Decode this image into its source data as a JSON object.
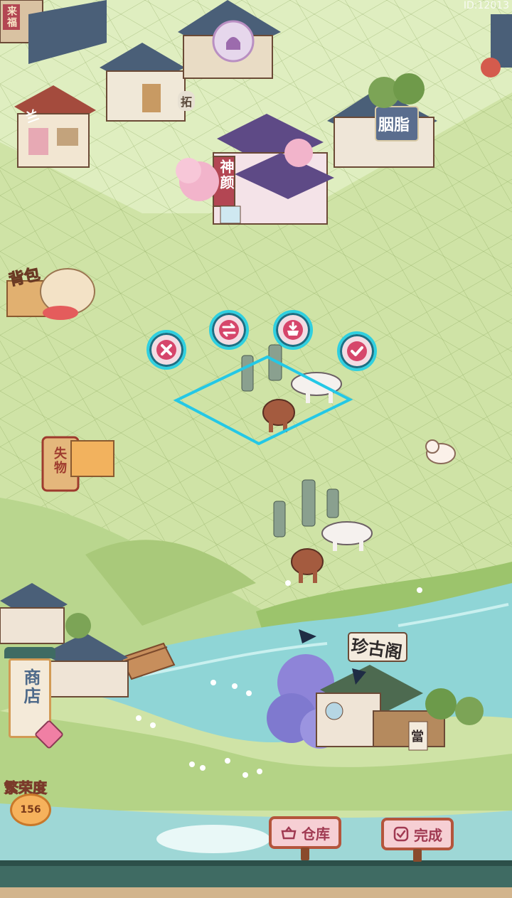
{
  "top_right_id": "ID:12013",
  "buildings": {
    "shenyan_sign": "神颜",
    "yanzhi_sign": "胭脂",
    "lan_sign": "兰",
    "top_left_sign": "来福",
    "tuo_sign": "拓",
    "zhenguge_sign": "珍古阁",
    "dang_sign": "當"
  },
  "left_panel": {
    "backpack_label": "背包",
    "lost_found_label": "失物",
    "shop_label": "商店",
    "prosperity_label": "繁荣度",
    "prosperity_value": "156"
  },
  "edit_controls": {
    "cancel": "cancel",
    "swap": "swap",
    "store": "store",
    "confirm": "confirm"
  },
  "bottom_bar": {
    "warehouse_label": "仓库",
    "done_label": "完成"
  },
  "colors": {
    "grass": "#cfe3a6",
    "river": "#8fd5d6",
    "selection": "#24c8e6",
    "button_ring": "#2fd0e0",
    "button_fill": "#f2dde4",
    "roof_dark": "#4a5f78",
    "wood": "#b4553c"
  }
}
